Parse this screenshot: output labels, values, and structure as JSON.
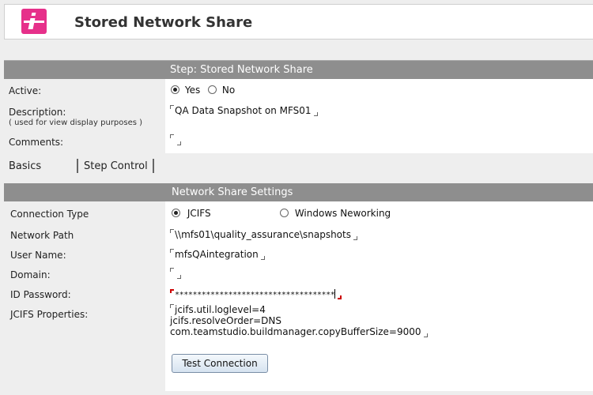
{
  "header": {
    "title": "Stored Network Share"
  },
  "step_bar": {
    "label": "Step:  Stored Network Share"
  },
  "general": {
    "active_label": "Active:",
    "active_yes": "Yes",
    "active_no": "No",
    "active_value": "Yes",
    "description_label": "Description:",
    "description_hint": "( used for view display purposes )",
    "description_value": "QA Data Snapshot on MFS01",
    "comments_label": "Comments:",
    "comments_value": ""
  },
  "tabs": [
    {
      "label": "Basics",
      "selected": true
    },
    {
      "label": "Step Control",
      "selected": false
    }
  ],
  "settings": {
    "section_title": "Network Share Settings",
    "connection_type_label": "Connection Type",
    "connection_jcifs": "JCIFS",
    "connection_windows": "Windows Neworking",
    "connection_selected": "JCIFS",
    "network_path_label": "Network Path",
    "network_path_value": "\\\\mfs01\\quality_assurance\\snapshots",
    "user_name_label": "User Name:",
    "user_name_value": "mfsQAintegration",
    "domain_label": "Domain:",
    "domain_value": "",
    "password_label": "ID Password:",
    "password_value": "************************************",
    "jcifs_properties_label": "JCIFS Properties:",
    "jcifs_properties_lines": [
      "jcifs.util.loglevel=4",
      "jcifs.resolveOrder=DNS",
      "com.teamstudio.buildmanager.copyBufferSize=9000"
    ],
    "test_button": "Test Connection"
  },
  "colors": {
    "brand": "#e6308a",
    "bar": "#8e8e8e",
    "page_bg": "#eeeeee"
  }
}
